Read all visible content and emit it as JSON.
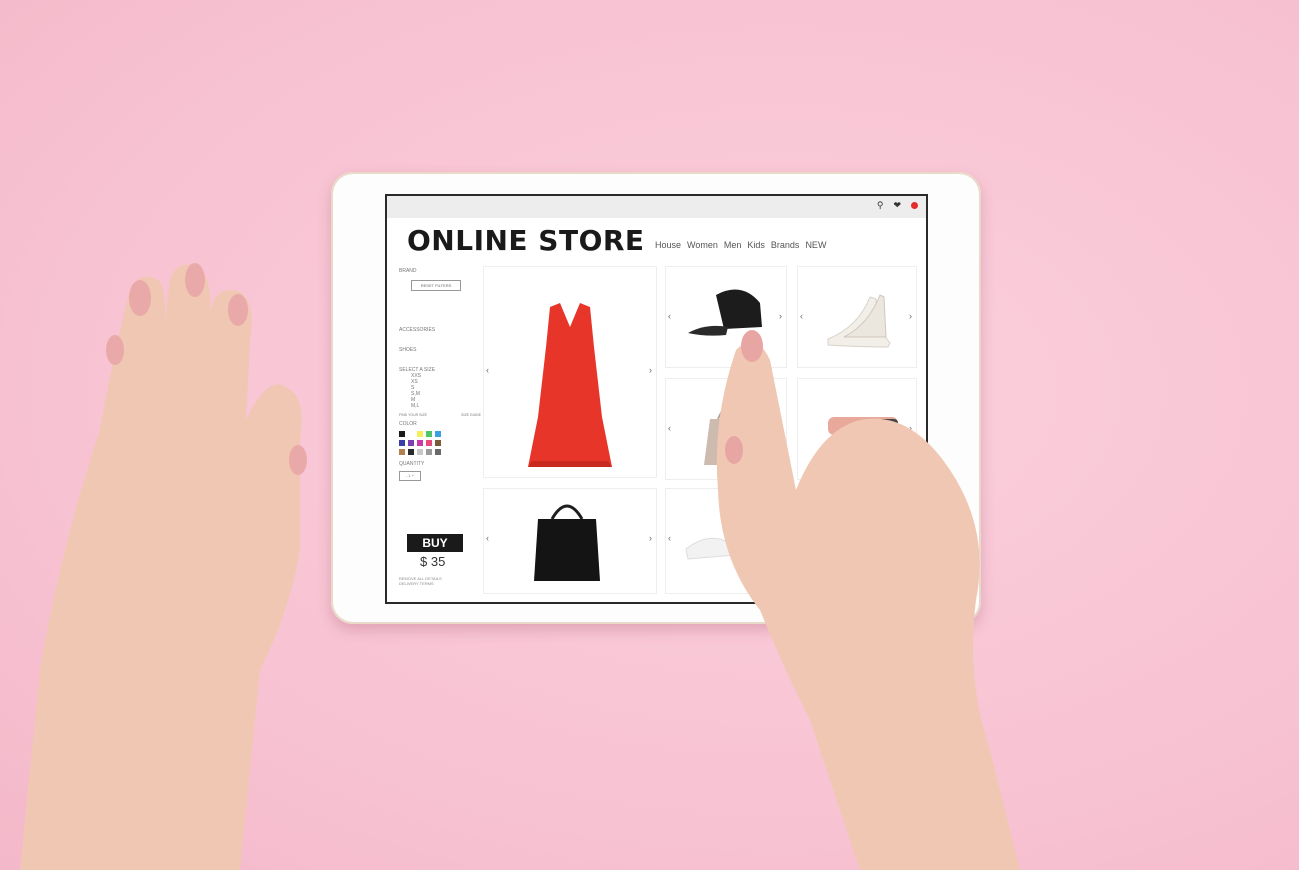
{
  "store": {
    "title": "ONLINE STORE",
    "nav": [
      "House",
      "Women",
      "Men",
      "Kids",
      "Brands",
      "NEW"
    ]
  },
  "sidebar": {
    "brand": "BRAND",
    "reset": "RESET FILTERS",
    "accessories": "ACCESSORIES",
    "shoes": "SHOES",
    "select_size": "SELECT A SIZE",
    "sizes": [
      "XXS",
      "XS",
      "S",
      "S,M",
      "M",
      "M,L"
    ],
    "size_guide_left": "FIND YOUR SIZE",
    "size_guide_right": "SIZE GUIDE",
    "color": "COLOR",
    "quantity": "QUANTITY",
    "qty_value": "- 1 +",
    "fine1": "REMOVE ALL DETAILS",
    "fine2": "DELIVERY TERMS"
  },
  "buy": {
    "label": "BUY",
    "price": "$ 35"
  },
  "colors": {
    "swatches": [
      "#1a1a1a",
      "#ffffff",
      "#f5ef5a",
      "#4fc46b",
      "#3aa0e0",
      "#3a3fa8",
      "#7b3fb0",
      "#c83aa8",
      "#e84a7a",
      "#7a5a3a",
      "#b08050",
      "#2a2a2a",
      "#c8c8c8",
      "#9a9a9a",
      "#6a6a6a"
    ],
    "accent": "#e52b2b"
  },
  "icons": {
    "search": "search-icon",
    "heart": "heart-icon",
    "cart": "cart-icon"
  }
}
